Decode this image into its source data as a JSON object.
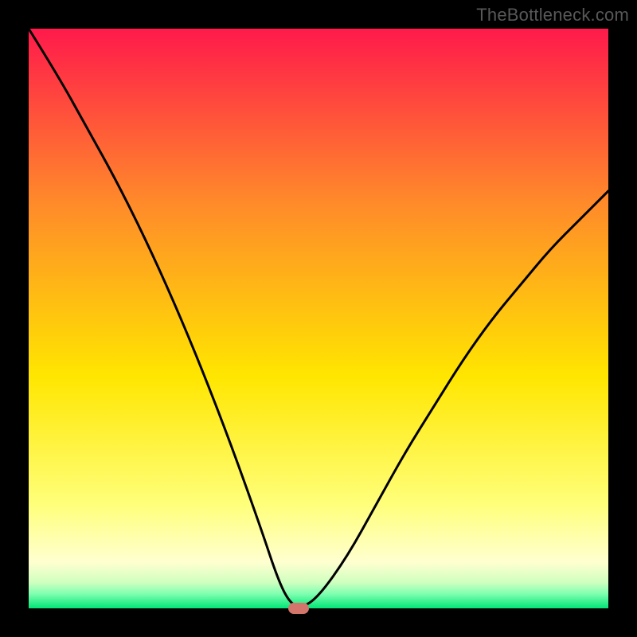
{
  "watermark": {
    "text": "TheBottleneck.com"
  },
  "colors": {
    "black": "#000000",
    "curve": "#000000",
    "marker": "#d4756c",
    "grad_top": "#ff1a4b",
    "grad_mid_upper": "#ff8a2a",
    "grad_mid": "#ffe600",
    "grad_low_yellow": "#ffff7a",
    "grad_green_light": "#7fffb0",
    "grad_green": "#00e676"
  },
  "chart_data": {
    "type": "line",
    "title": "",
    "xlabel": "",
    "ylabel": "",
    "xlim": [
      0,
      100
    ],
    "ylim": [
      0,
      100
    ],
    "series": [
      {
        "name": "bottleneck-curve",
        "x": [
          0,
          5,
          10,
          15,
          20,
          25,
          30,
          35,
          40,
          43,
          45,
          47,
          50,
          55,
          60,
          65,
          70,
          75,
          80,
          85,
          90,
          95,
          100
        ],
        "y": [
          100,
          92,
          83,
          74,
          64,
          53,
          41,
          28,
          14,
          5,
          1,
          0,
          2,
          9,
          18,
          27,
          35,
          43,
          50,
          56,
          62,
          67,
          72
        ]
      }
    ],
    "marker": {
      "x": 46.5,
      "y": 0
    },
    "gradient_stops": [
      {
        "pos": 0.0,
        "color": "#ff1a4b"
      },
      {
        "pos": 0.3,
        "color": "#ff8a2a"
      },
      {
        "pos": 0.6,
        "color": "#ffe600"
      },
      {
        "pos": 0.82,
        "color": "#ffff7a"
      },
      {
        "pos": 0.92,
        "color": "#ffffd0"
      },
      {
        "pos": 0.955,
        "color": "#d0ffc0"
      },
      {
        "pos": 0.975,
        "color": "#7fffb0"
      },
      {
        "pos": 1.0,
        "color": "#00e676"
      }
    ]
  }
}
